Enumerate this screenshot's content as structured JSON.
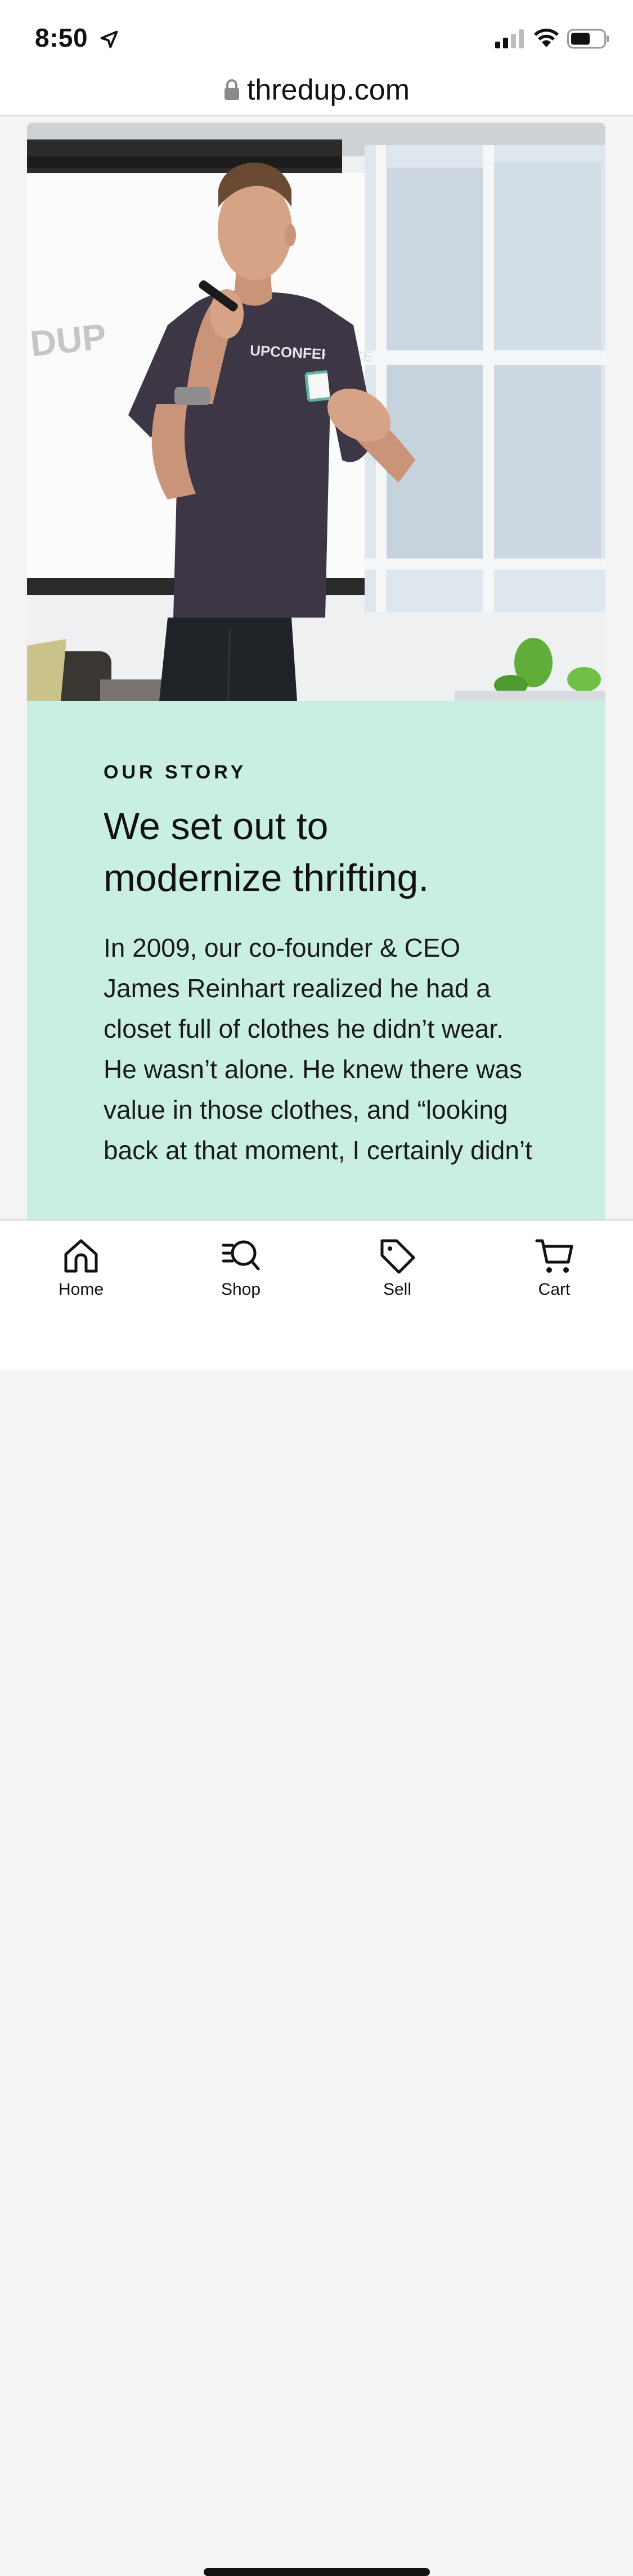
{
  "status_bar": {
    "time": "8:50"
  },
  "browser": {
    "url": "thredup.com"
  },
  "hero": {
    "wall_text": "DUP",
    "shirt_text": "UPCONFERENCE"
  },
  "story": {
    "eyebrow": "OUR STORY",
    "headline_line1": "We set out to",
    "headline_line2": "modernize thrifting.",
    "body": "In 2009, our co-founder & CEO James Reinhart realized he had a closet full of clothes he didn’t wear. He wasn’t alone. He knew there was value in those clothes, and “looking back at that moment, I certainly didn’t"
  },
  "bottom_nav": {
    "items": [
      {
        "label": "Home",
        "icon": "home-icon"
      },
      {
        "label": "Shop",
        "icon": "shop-search-icon"
      },
      {
        "label": "Sell",
        "icon": "tag-icon"
      },
      {
        "label": "Cart",
        "icon": "cart-icon"
      }
    ]
  }
}
